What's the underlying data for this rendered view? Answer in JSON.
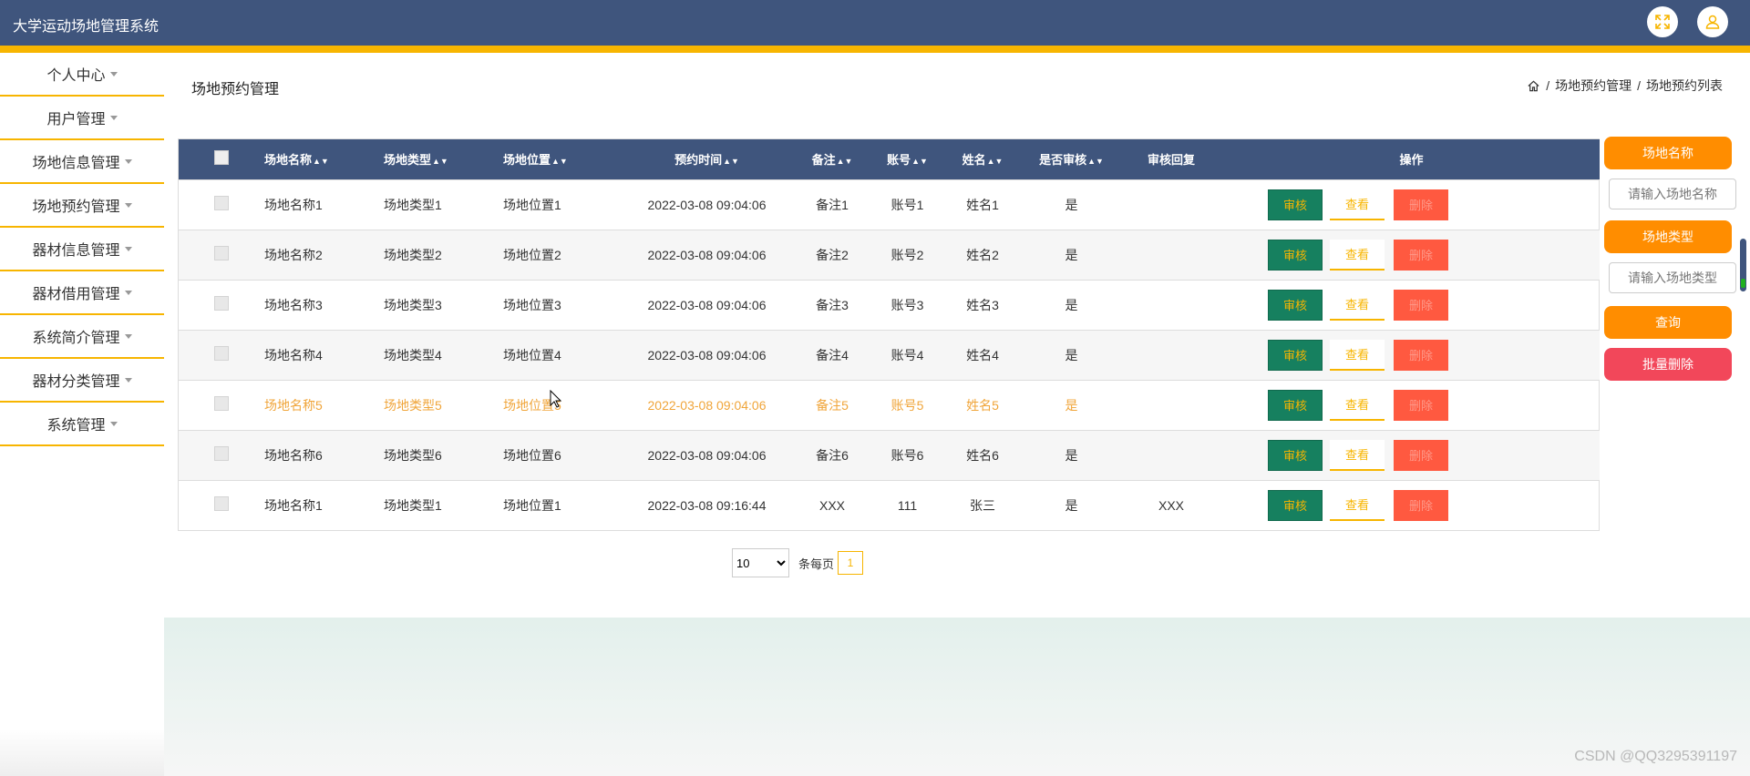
{
  "app_title": "大学运动场地管理系统",
  "sidebar": {
    "items": [
      {
        "label": "个人中心"
      },
      {
        "label": "用户管理"
      },
      {
        "label": "场地信息管理"
      },
      {
        "label": "场地预约管理"
      },
      {
        "label": "器材信息管理"
      },
      {
        "label": "器材借用管理"
      },
      {
        "label": "系统简介管理"
      },
      {
        "label": "器材分类管理"
      },
      {
        "label": "系统管理"
      }
    ]
  },
  "page": {
    "title": "场地预约管理",
    "breadcrumb": [
      "场地预约管理",
      "场地预约列表"
    ],
    "breadcrumb_sep": "/"
  },
  "table": {
    "headers": [
      "场地名称",
      "场地类型",
      "场地位置",
      "预约时间",
      "备注",
      "账号",
      "姓名",
      "是否审核",
      "审核回复",
      "操作"
    ],
    "action_labels": {
      "audit": "审核",
      "view": "查看",
      "delete": "删除"
    },
    "rows": [
      [
        "场地名称1",
        "场地类型1",
        "场地位置1",
        "2022-03-08 09:04:06",
        "备注1",
        "账号1",
        "姓名1",
        "是",
        ""
      ],
      [
        "场地名称2",
        "场地类型2",
        "场地位置2",
        "2022-03-08 09:04:06",
        "备注2",
        "账号2",
        "姓名2",
        "是",
        ""
      ],
      [
        "场地名称3",
        "场地类型3",
        "场地位置3",
        "2022-03-08 09:04:06",
        "备注3",
        "账号3",
        "姓名3",
        "是",
        ""
      ],
      [
        "场地名称4",
        "场地类型4",
        "场地位置4",
        "2022-03-08 09:04:06",
        "备注4",
        "账号4",
        "姓名4",
        "是",
        ""
      ],
      [
        "场地名称5",
        "场地类型5",
        "场地位置5",
        "2022-03-08 09:04:06",
        "备注5",
        "账号5",
        "姓名5",
        "是",
        ""
      ],
      [
        "场地名称6",
        "场地类型6",
        "场地位置6",
        "2022-03-08 09:04:06",
        "备注6",
        "账号6",
        "姓名6",
        "是",
        ""
      ],
      [
        "场地名称1",
        "场地类型1",
        "场地位置1",
        "2022-03-08 09:16:44",
        "XXX",
        "111",
        "张三",
        "是",
        "XXX"
      ]
    ]
  },
  "pagination": {
    "page_size": "10",
    "per_page_label": "条每页",
    "current_page": "1"
  },
  "search_panel": {
    "field1_label": "场地名称",
    "field1_placeholder": "请输入场地名称",
    "field2_label": "场地类型",
    "field2_placeholder": "请输入场地类型",
    "query_label": "查询",
    "batch_delete_label": "批量删除"
  },
  "watermark": "CSDN @QQ3295391197",
  "colors": {
    "header_blue": "#3f557d",
    "accent_yellow": "#f7b500",
    "orange_button": "#ff8d00",
    "audit_green": "#16805f",
    "delete_red": "#ff5940",
    "highlight_row_text": "#f0a53a"
  },
  "icons": {
    "fullscreen": "fullscreen-icon",
    "user": "user-icon",
    "home": "home-icon",
    "sort": "sort-icon",
    "caret": "caret-down-icon"
  }
}
